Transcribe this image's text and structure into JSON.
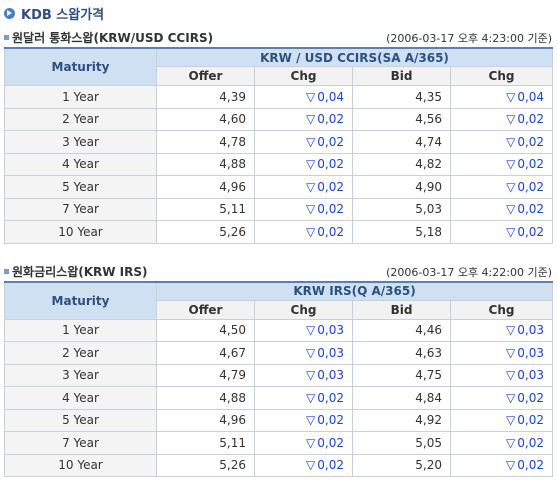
{
  "page": {
    "title": "KDB 스왑가격"
  },
  "icons": {
    "header": "arrow-circle-icon",
    "section": "square-bullet-icon",
    "change": "down-triangle-icon"
  },
  "colors": {
    "accent": "#2f4f7f",
    "header_bg": "#cfe0f3",
    "change_text": "#1f44c8"
  },
  "ccirs": {
    "title": "원달러 통화스왑(KRW/USD CCIRS)",
    "timestamp": "(2006-03-17 오후 4:23:00 기준)",
    "group_header": "KRW / USD CCIRS(SA A/365)",
    "columns": [
      "Maturity",
      "Offer",
      "Chg",
      "Bid",
      "Chg"
    ],
    "rows": [
      {
        "maturity": "1 Year",
        "offer": "4,39",
        "offer_chg": "0,04",
        "bid": "4,35",
        "bid_chg": "0,04"
      },
      {
        "maturity": "2 Year",
        "offer": "4,60",
        "offer_chg": "0,02",
        "bid": "4,56",
        "bid_chg": "0,02"
      },
      {
        "maturity": "3 Year",
        "offer": "4,78",
        "offer_chg": "0,02",
        "bid": "4,74",
        "bid_chg": "0,02"
      },
      {
        "maturity": "4 Year",
        "offer": "4,88",
        "offer_chg": "0,02",
        "bid": "4,82",
        "bid_chg": "0,02"
      },
      {
        "maturity": "5 Year",
        "offer": "4,96",
        "offer_chg": "0,02",
        "bid": "4,90",
        "bid_chg": "0,02"
      },
      {
        "maturity": "7 Year",
        "offer": "5,11",
        "offer_chg": "0,02",
        "bid": "5,03",
        "bid_chg": "0,02"
      },
      {
        "maturity": "10 Year",
        "offer": "5,26",
        "offer_chg": "0,02",
        "bid": "5,18",
        "bid_chg": "0,02"
      }
    ]
  },
  "irs": {
    "title": "원화금리스왑(KRW IRS)",
    "timestamp": "(2006-03-17 오후 4:22:00 기준)",
    "group_header": "KRW IRS(Q A/365)",
    "columns": [
      "Maturity",
      "Offer",
      "Chg",
      "Bid",
      "Chg"
    ],
    "rows": [
      {
        "maturity": "1 Year",
        "offer": "4,50",
        "offer_chg": "0,03",
        "bid": "4,46",
        "bid_chg": "0,03"
      },
      {
        "maturity": "2 Year",
        "offer": "4,67",
        "offer_chg": "0,03",
        "bid": "4,63",
        "bid_chg": "0,03"
      },
      {
        "maturity": "3 Year",
        "offer": "4,79",
        "offer_chg": "0,03",
        "bid": "4,75",
        "bid_chg": "0,03"
      },
      {
        "maturity": "4 Year",
        "offer": "4,88",
        "offer_chg": "0,02",
        "bid": "4,84",
        "bid_chg": "0,02"
      },
      {
        "maturity": "5 Year",
        "offer": "4,96",
        "offer_chg": "0,02",
        "bid": "4,92",
        "bid_chg": "0,02"
      },
      {
        "maturity": "7 Year",
        "offer": "5,11",
        "offer_chg": "0,02",
        "bid": "5,05",
        "bid_chg": "0,02"
      },
      {
        "maturity": "10 Year",
        "offer": "5,26",
        "offer_chg": "0,02",
        "bid": "5,20",
        "bid_chg": "0,02"
      }
    ]
  }
}
